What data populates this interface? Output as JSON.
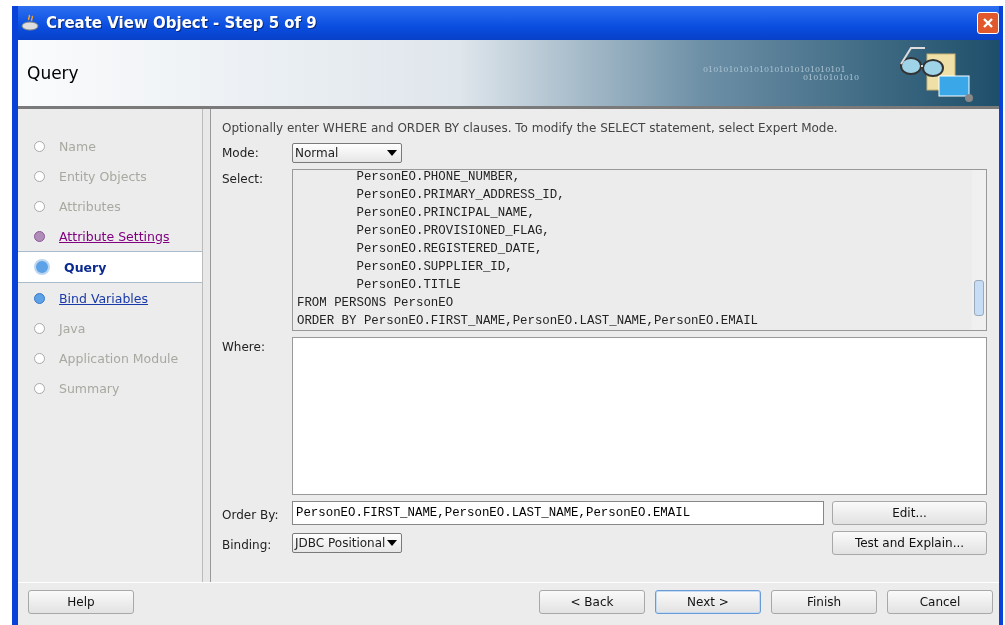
{
  "window": {
    "title": "Create View Object - Step 5 of 9"
  },
  "header": {
    "title": "Query",
    "banner_text": [
      "0101010101010101010101010101",
      "01010101010"
    ]
  },
  "steps": [
    {
      "label": "Name",
      "kind": "disabled",
      "selected": false
    },
    {
      "label": "Entity Objects",
      "kind": "disabled",
      "selected": false
    },
    {
      "label": "Attributes",
      "kind": "disabled",
      "selected": false
    },
    {
      "label": "Attribute Settings",
      "kind": "visited",
      "selected": false
    },
    {
      "label": "Query",
      "kind": "current",
      "selected": true
    },
    {
      "label": "Bind Variables",
      "kind": "link",
      "selected": false
    },
    {
      "label": "Java",
      "kind": "disabled",
      "selected": false
    },
    {
      "label": "Application Module",
      "kind": "disabled",
      "selected": false
    },
    {
      "label": "Summary",
      "kind": "disabled",
      "selected": false
    }
  ],
  "instructions": "Optionally enter WHERE and ORDER BY clauses. To modify the SELECT statement, select Expert Mode.",
  "mode": {
    "label": "Mode:",
    "value": "Normal"
  },
  "select": {
    "label": "Select:",
    "lines": [
      "        PersonEO.PHONE_NUMBER,",
      "        PersonEO.PRIMARY_ADDRESS_ID,",
      "        PersonEO.PRINCIPAL_NAME,",
      "        PersonEO.PROVISIONED_FLAG,",
      "        PersonEO.REGISTERED_DATE,",
      "        PersonEO.SUPPLIER_ID,",
      "        PersonEO.TITLE",
      "FROM PERSONS PersonEO",
      "ORDER BY PersonEO.FIRST_NAME,PersonEO.LAST_NAME,PersonEO.EMAIL"
    ]
  },
  "where": {
    "label": "Where:"
  },
  "order_by": {
    "label": "Order By:",
    "value": "PersonEO.FIRST_NAME,PersonEO.LAST_NAME,PersonEO.EMAIL",
    "button": "Edit..."
  },
  "binding": {
    "label": "Binding:",
    "value": "JDBC Positional",
    "button": "Test and Explain..."
  },
  "buttons": {
    "help": "Help",
    "nav": [
      {
        "label": "< Back",
        "selected": false
      },
      {
        "label": "Next >",
        "selected": true
      },
      {
        "label": "Finish",
        "selected": false
      },
      {
        "label": "Cancel",
        "selected": false
      }
    ]
  }
}
